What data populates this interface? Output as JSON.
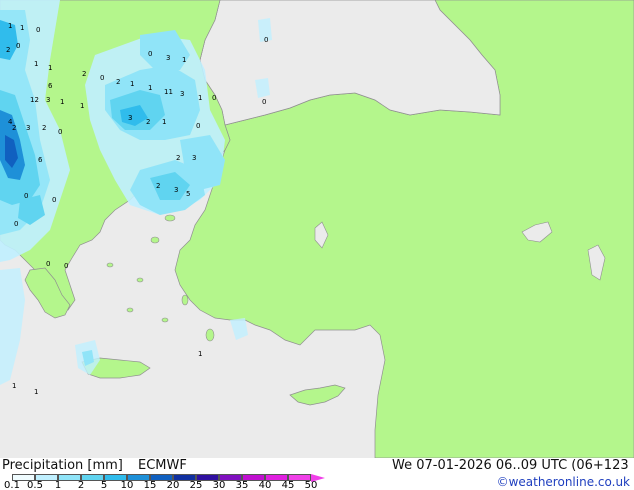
{
  "title": "Precipitation [mm]",
  "model": "ECMWF",
  "valid_time": "We 07-01-2026 06..09 UTC (06+123",
  "credit": "©weatheronline.co.uk",
  "colors": {
    "sea": "#ebebeb",
    "land": "#b4f68c",
    "border": "#a0a0a0",
    "coast": "#909090"
  },
  "legend": {
    "ticks": [
      "0.1",
      "0.5",
      "1",
      "2",
      "5",
      "10",
      "15",
      "20",
      "25",
      "30",
      "35",
      "40",
      "45",
      "50"
    ],
    "colors": [
      "#f0fcff",
      "#c0f0ff",
      "#90e4f8",
      "#60d4f0",
      "#30bcec",
      "#1e90d8",
      "#1060c0",
      "#1030a0",
      "#3010a0",
      "#8010c0",
      "#c010d0",
      "#e020e0",
      "#f040e8"
    ]
  },
  "value_labels": [
    "1",
    "1",
    "0",
    "0",
    "1",
    "1",
    "6",
    "2",
    "2",
    "0",
    "2",
    "1",
    "0",
    "3",
    "1",
    "1",
    "11",
    "3",
    "1",
    "0",
    "0",
    "12",
    "3",
    "1",
    "1",
    "3",
    "2",
    "1",
    "2",
    "3",
    "4",
    "2",
    "6",
    "0",
    "3",
    "2",
    "2",
    "3",
    "5",
    "0",
    "0",
    "0",
    "0",
    "0",
    "1",
    "1",
    "1",
    "0",
    "0"
  ]
}
